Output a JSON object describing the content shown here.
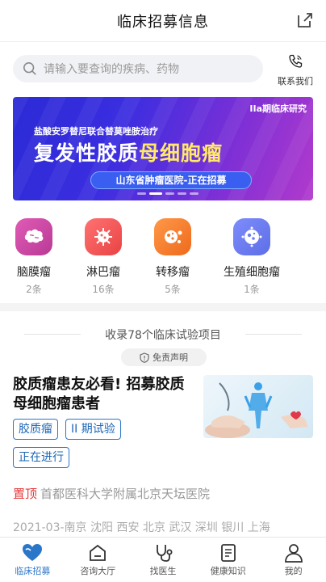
{
  "header": {
    "title": "临床招募信息",
    "share_icon": "share-icon"
  },
  "search": {
    "placeholder": "请输入要查询的疾病、药物",
    "contact_label": "联系我们"
  },
  "banner": {
    "tag": "IIa期临床研究",
    "drug": "盐酸安罗替尼联合替莫唑胺治疗",
    "headline_a": "复发性胶质",
    "headline_b": "母细胞瘤",
    "pill": "山东省肿瘤医院-正在招募",
    "slide_count": 5,
    "active_slide": 1
  },
  "categories": [
    {
      "name": "脑膜瘤",
      "count": "2条",
      "color": "#d24aa8",
      "icon": "brain-icon"
    },
    {
      "name": "淋巴瘤",
      "count": "16条",
      "color": "#f05a5a",
      "icon": "lymph-icon"
    },
    {
      "name": "转移瘤",
      "count": "5条",
      "color": "#f3782c",
      "icon": "virus-icon"
    },
    {
      "name": "生殖细胞瘤",
      "count": "1条",
      "color": "#6c7ff2",
      "icon": "cell-icon"
    }
  ],
  "collection": {
    "title": "收录78个临床试验项目",
    "disclaimer": "免责声明"
  },
  "trial": {
    "title": "胶质瘤患友必看! 招募胶质母细胞瘤患者",
    "tags": [
      "胶质瘤",
      "II 期试验",
      "正在进行"
    ],
    "top_label": "置顶",
    "hospital": "首都医科大学附属北京天坛医院",
    "cities": "2021-03-南京  沈阳  西安  北京  武汉  深圳  银川  上海"
  },
  "tabbar": [
    {
      "label": "临床招募",
      "icon": "heart-icon",
      "active": true
    },
    {
      "label": "咨询大厅",
      "icon": "chat-icon",
      "active": false
    },
    {
      "label": "找医生",
      "icon": "stethoscope-icon",
      "active": false
    },
    {
      "label": "健康知识",
      "icon": "book-icon",
      "active": false
    },
    {
      "label": "我的",
      "icon": "user-icon",
      "active": false
    }
  ],
  "colors": {
    "accent": "#2a76c8",
    "highlight": "#e33b3b"
  }
}
